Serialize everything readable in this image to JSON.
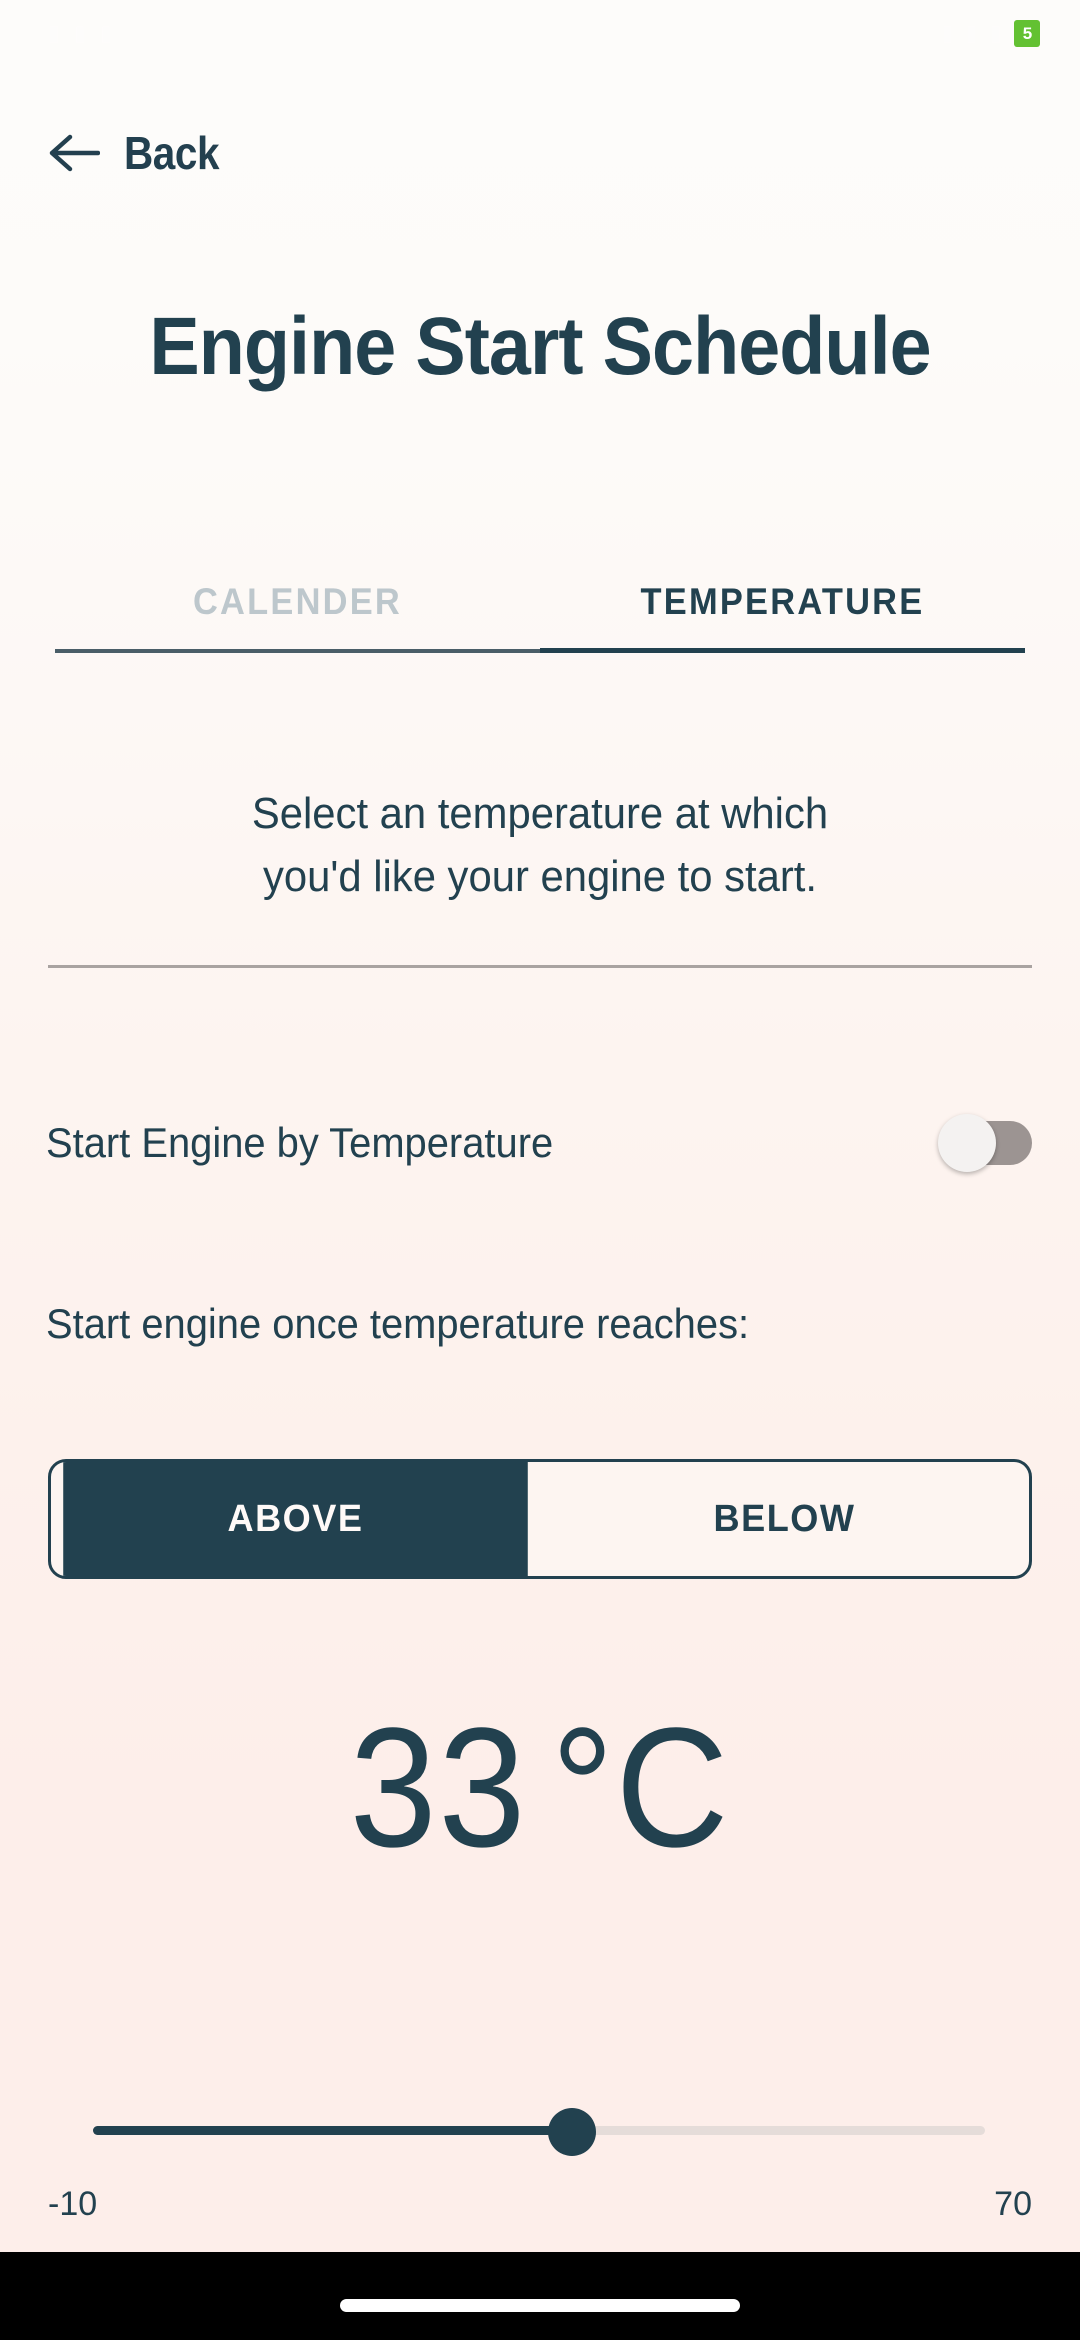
{
  "statusbar": {
    "icons_left": [
      "▮",
      "▮",
      "▮"
    ],
    "time": "",
    "icons_right": [
      "▮",
      "▮",
      "▮"
    ],
    "battery_text": "5",
    "battery_color": "#63c132"
  },
  "nav": {
    "back_label": "Back",
    "back_icon": "arrow-left-icon"
  },
  "header": {
    "title": "Engine Start Schedule"
  },
  "tabs": [
    {
      "label": "CALENDER",
      "active": false
    },
    {
      "label": "TEMPERATURE",
      "active": true
    }
  ],
  "main": {
    "description_line1": "Select an temperature at which",
    "description_line2": "you'd like your engine to start.",
    "toggle_label": "Start Engine by Temperature",
    "toggle_state": "off",
    "reaches_label": "Start engine once temperature reaches:",
    "segments": [
      {
        "label": "ABOVE",
        "selected": true
      },
      {
        "label": "BELOW",
        "selected": false
      }
    ],
    "temperature_value": "33",
    "temperature_unit": "°C",
    "slider": {
      "value": 33,
      "min_label": "-10",
      "max_label": "70",
      "min": -10,
      "max": 70,
      "fill_percent": 53.75
    }
  },
  "theme": {
    "accent": "#22414f",
    "inactive": "#bdc7cc",
    "track_off": "#9c9492",
    "slider_bg": "#e5dcd9",
    "surface": "#fdf5f1"
  }
}
